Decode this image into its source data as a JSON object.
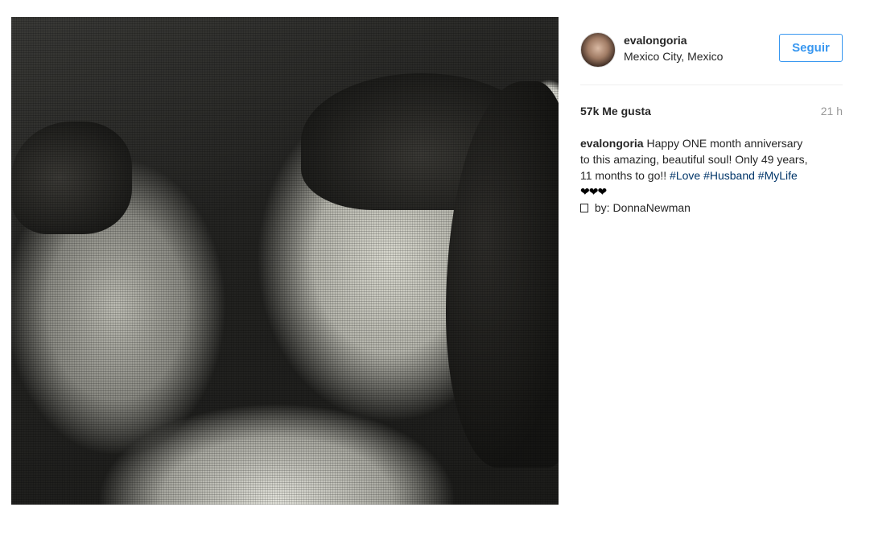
{
  "post": {
    "photo_icon": "couple-photo",
    "username": "evalongoria",
    "location": "Mexico City, Mexico",
    "follow_label": "Seguir",
    "likes": "57k Me gusta",
    "time": "21 h",
    "caption": {
      "user": "evalongoria",
      "text_1": " Happy ONE month anniversary to this amazing, beautiful soul! Only 49 years, 11 months to go!! ",
      "tags": [
        "#Love",
        "#Husband",
        "#MyLife"
      ],
      "hearts": "❤❤❤",
      "credit": " by: DonnaNewman"
    }
  },
  "colors": {
    "accent": "#3897f0",
    "hashtag": "#003569",
    "muted": "#999999",
    "text": "#262626"
  }
}
